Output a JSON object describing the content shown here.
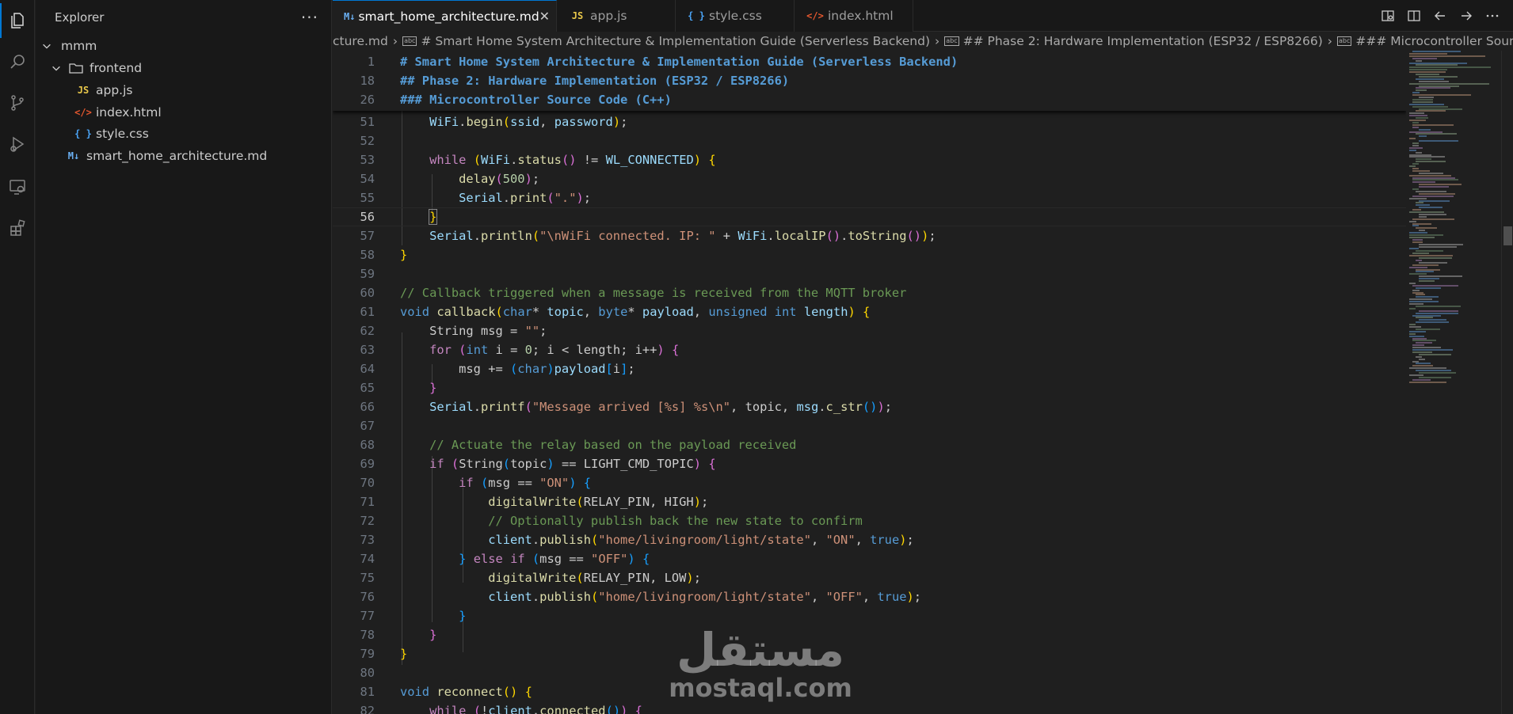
{
  "activity_bar": {
    "icons": [
      "explorer-icon",
      "search-icon",
      "source-control-icon",
      "run-debug-icon",
      "remote-explorer-icon",
      "extensions-icon"
    ]
  },
  "sidebar": {
    "title": "Explorer",
    "more": "···",
    "tree": [
      {
        "label": "mmm",
        "type": "folder",
        "expanded": true
      },
      {
        "label": "frontend",
        "type": "folder",
        "expanded": true
      },
      {
        "label": "app.js",
        "type": "js",
        "icon_text": "JS"
      },
      {
        "label": "index.html",
        "type": "html",
        "icon_text": "</>"
      },
      {
        "label": "style.css",
        "type": "css",
        "icon_text": "{ }"
      },
      {
        "label": "smart_home_architecture.md",
        "type": "md",
        "icon_text": "M↓"
      }
    ]
  },
  "tabs": [
    {
      "label": "smart_home_architecture.md",
      "icon_text": "M↓",
      "active": true,
      "close": "✕"
    },
    {
      "label": "app.js",
      "icon_text": "JS",
      "active": false
    },
    {
      "label": "style.css",
      "icon_text": "{ }",
      "active": false
    },
    {
      "label": "index.html",
      "icon_text": "</>",
      "active": false
    }
  ],
  "breadcrumb": [
    "cture.md",
    "# Smart Home System Architecture & Implementation Guide (Serverless Backend)",
    "## Phase 2: Hardware Implementation (ESP32 / ESP8266)",
    "### Microcontroller Source Code (C++)"
  ],
  "breadcrumb_abc": "abc",
  "sticky": [
    {
      "num": "1",
      "text": "# Smart Home System Architecture & Implementation Guide (Serverless Backend)"
    },
    {
      "num": "18",
      "text": "## Phase 2: Hardware Implementation (ESP32 / ESP8266)"
    },
    {
      "num": "26",
      "text": "### Microcontroller Source Code (C++)"
    }
  ],
  "code_lines": [
    "51",
    "52",
    "53",
    "54",
    "55",
    "56",
    "57",
    "58",
    "59",
    "60",
    "61",
    "62",
    "63",
    "64",
    "65",
    "66",
    "67",
    "68",
    "69",
    "70",
    "71",
    "72",
    "73",
    "74",
    "75",
    "76",
    "77",
    "78",
    "79",
    "80",
    "81",
    "82"
  ],
  "current_line": "56",
  "watermark": {
    "arabic": "مستقل",
    "latin": "mostaql.com"
  },
  "colors": {
    "accent": "#0078d4",
    "background": "#1f1f1f",
    "sidebar": "#181818"
  }
}
